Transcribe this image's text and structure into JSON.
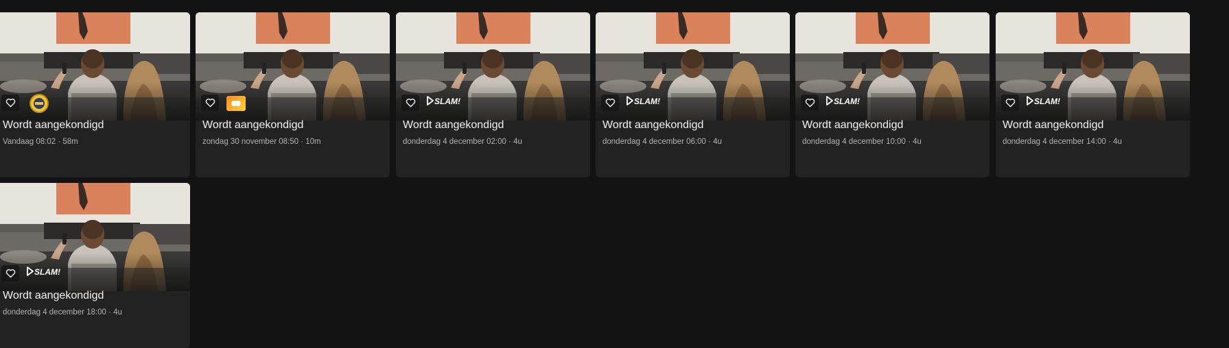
{
  "colors": {
    "background": "#131313",
    "card": "#222222",
    "meta_text": "#b3b3b3"
  },
  "icons": {
    "favorite": "heart-outline-icon"
  },
  "cards": [
    {
      "title": "Wordt aangekondigd",
      "meta": "Vandaag 08:02 · 58m",
      "channel_logo": "badge-logo"
    },
    {
      "title": "Wordt aangekondigd",
      "meta": "zondag 30 november 08:50 · 10m",
      "channel_logo": "orange-logo"
    },
    {
      "title": "Wordt aangekondigd",
      "meta": "donderdag 4 december 02:00 · 4u",
      "channel_logo": "SLAM!"
    },
    {
      "title": "Wordt aangekondigd",
      "meta": "donderdag 4 december 06:00 · 4u",
      "channel_logo": "SLAM!"
    },
    {
      "title": "Wordt aangekondigd",
      "meta": "donderdag 4 december 10:00 · 4u",
      "channel_logo": "SLAM!"
    },
    {
      "title": "Wordt aangekondigd",
      "meta": "donderdag 4 december 14:00 · 4u",
      "channel_logo": "SLAM!"
    },
    {
      "title": "Wordt aangekondigd",
      "meta": "donderdag 4 december 18:00 · 4u",
      "channel_logo": "SLAM!"
    }
  ]
}
